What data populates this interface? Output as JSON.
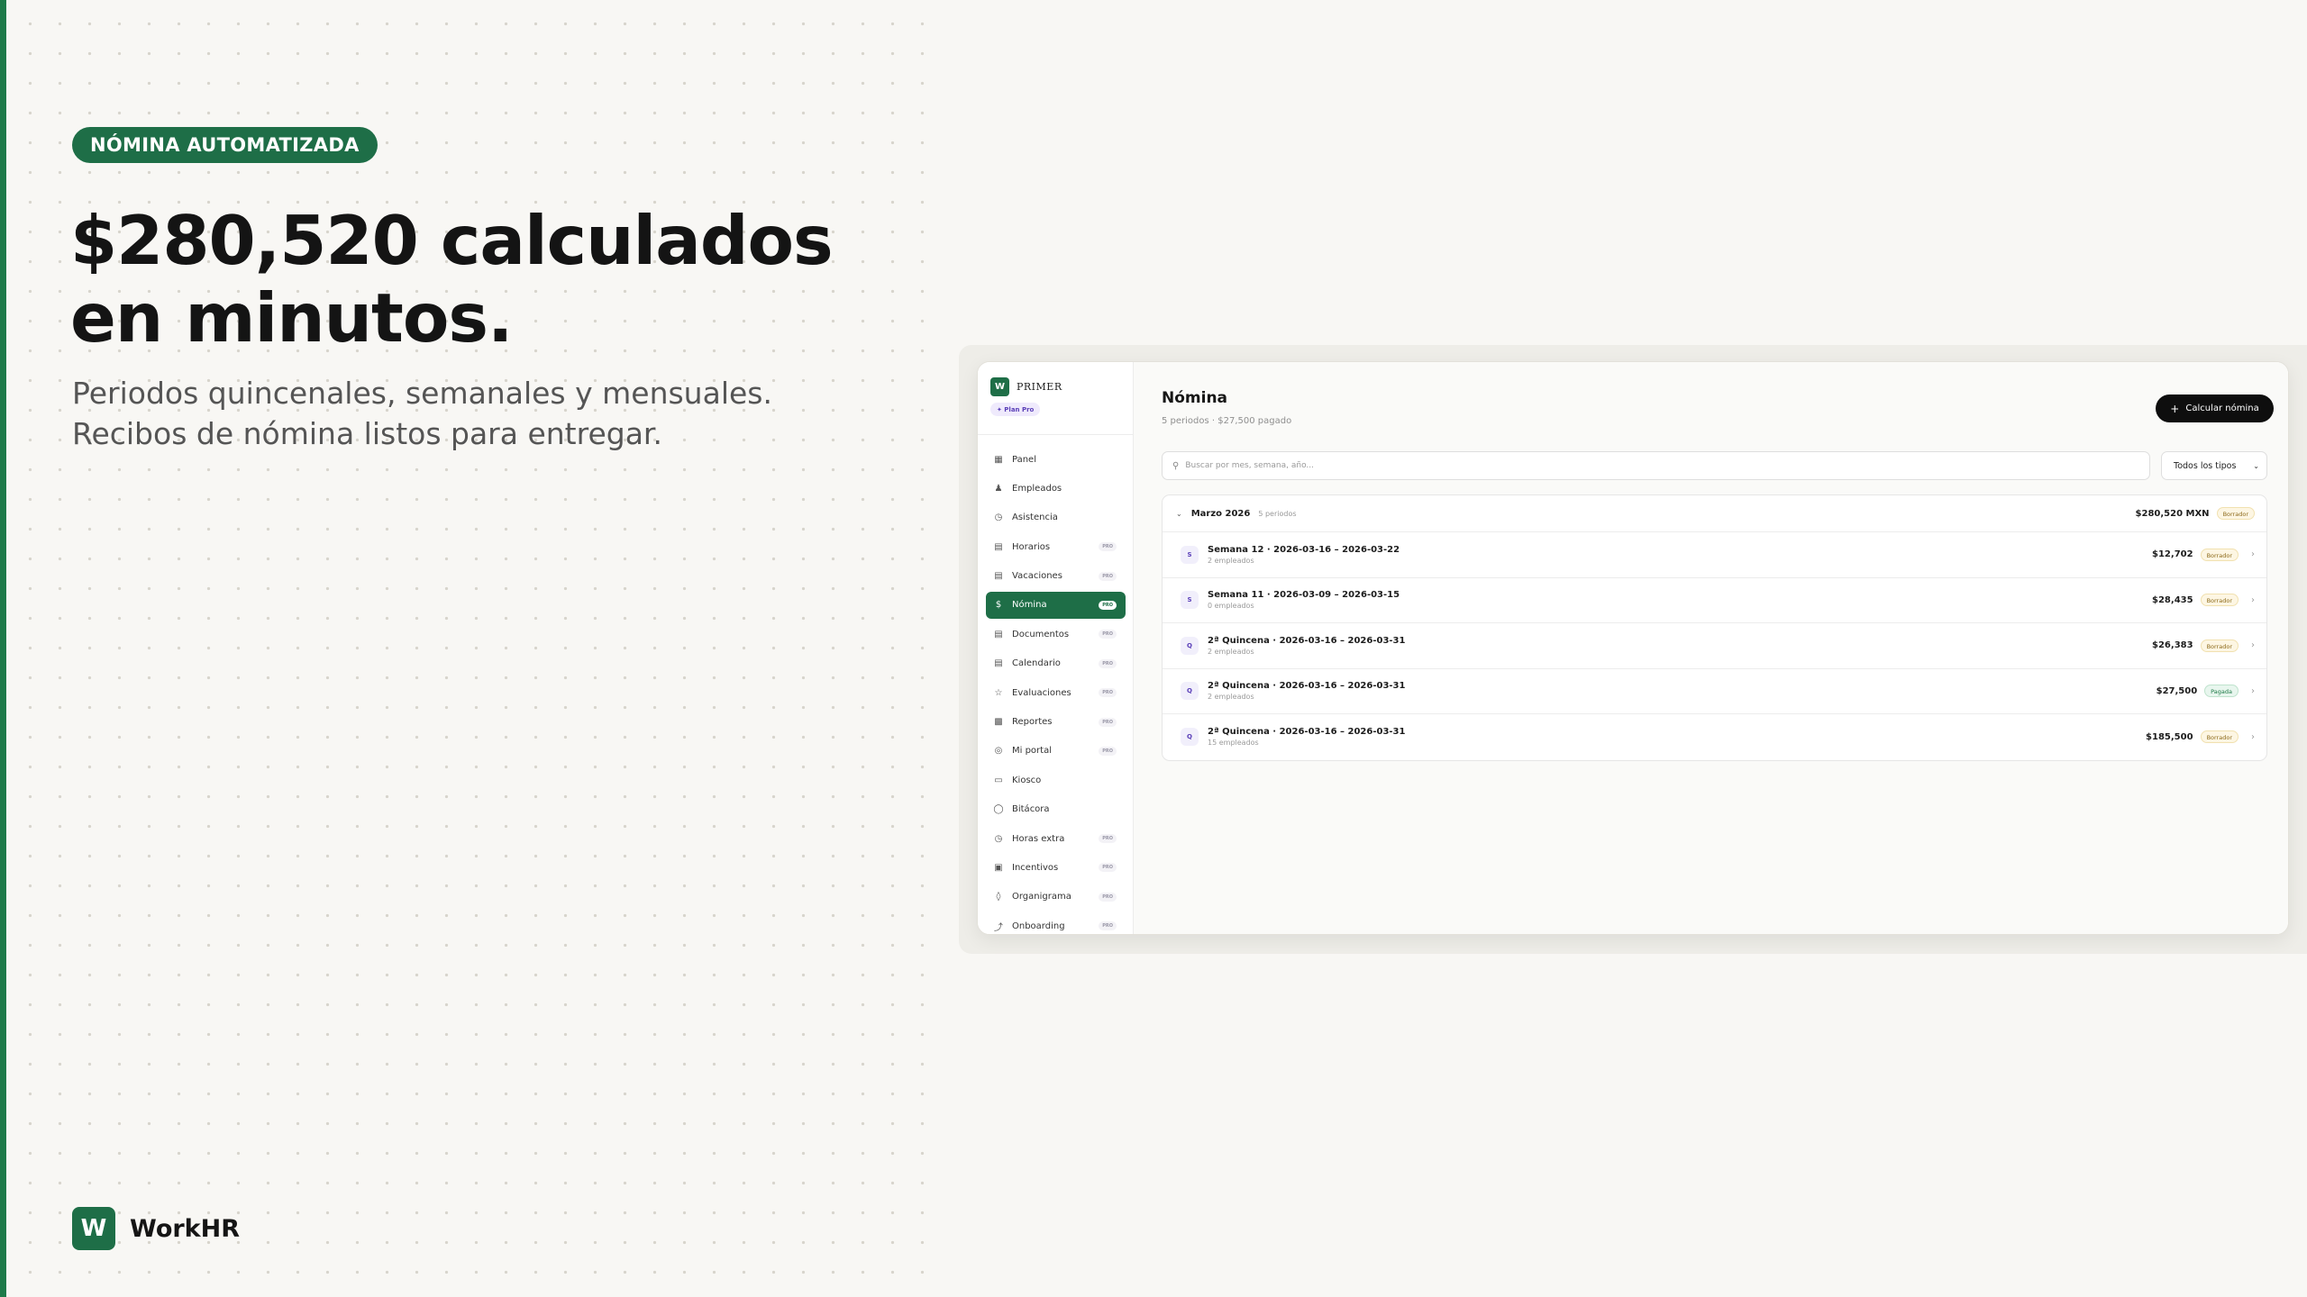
{
  "hero": {
    "badge": "NÓMINA AUTOMATIZADA",
    "title_line1": "$280,520 calculados",
    "title_line2": "en minutos.",
    "subtitle_line1": "Periodos quincenales, semanales y mensuales.",
    "subtitle_line2": "Recibos de nómina listos para entregar."
  },
  "brand": {
    "logo_letter": "W",
    "name": "WorkHR"
  },
  "colors": {
    "brand_green": "#1e6e47",
    "draft": "#8d6a1a",
    "paid": "#1f7a48",
    "pro_purple": "#5a3fb8"
  },
  "app": {
    "org": {
      "logo_letter": "W",
      "name": "PRIMER",
      "plan": "✦ Plan Pro"
    },
    "sidebar": {
      "items": [
        {
          "label": "Panel",
          "icon": "grid-icon",
          "pro": ""
        },
        {
          "label": "Empleados",
          "icon": "users-icon",
          "pro": ""
        },
        {
          "label": "Asistencia",
          "icon": "clock-icon",
          "pro": ""
        },
        {
          "label": "Horarios",
          "icon": "calendar-icon",
          "pro": "PRO"
        },
        {
          "label": "Vacaciones",
          "icon": "calendar-icon",
          "pro": "PRO"
        },
        {
          "label": "Nómina",
          "icon": "dollar-icon",
          "pro": "PRO"
        },
        {
          "label": "Documentos",
          "icon": "document-icon",
          "pro": "PRO"
        },
        {
          "label": "Calendario",
          "icon": "calendar-icon",
          "pro": "PRO"
        },
        {
          "label": "Evaluaciones",
          "icon": "star-icon",
          "pro": "PRO"
        },
        {
          "label": "Reportes",
          "icon": "bar-chart-icon",
          "pro": "PRO"
        },
        {
          "label": "Mi portal",
          "icon": "portal-icon",
          "pro": "PRO"
        },
        {
          "label": "Kiosco",
          "icon": "kiosk-icon",
          "pro": ""
        },
        {
          "label": "Bitácora",
          "icon": "shield-icon",
          "pro": ""
        },
        {
          "label": "Horas extra",
          "icon": "clock-icon",
          "pro": "PRO"
        },
        {
          "label": "Incentivos",
          "icon": "gift-icon",
          "pro": "PRO"
        },
        {
          "label": "Organigrama",
          "icon": "org-chart-icon",
          "pro": "PRO"
        },
        {
          "label": "Onboarding",
          "icon": "onboarding-icon",
          "pro": "PRO"
        }
      ]
    },
    "main": {
      "title": "Nómina",
      "subtitle": "5 periodos · $27,500 pagado",
      "calc_button": "Calcular nómina",
      "search_placeholder": "Buscar por mes, semana, año...",
      "filter_value": "Todos los tipos",
      "group": {
        "name": "Marzo 2026",
        "count": "5 periodos",
        "amount": "$280,520 MXN",
        "status": "Borrador"
      },
      "periods": [
        {
          "type": "S",
          "name": "Semana 12 · 2026-03-16 – 2026-03-22",
          "employees": "2 empleados",
          "amount": "$12,702",
          "status": "Borrador",
          "status_kind": "draft"
        },
        {
          "type": "S",
          "name": "Semana 11 · 2026-03-09 – 2026-03-15",
          "employees": "0 empleados",
          "amount": "$28,435",
          "status": "Borrador",
          "status_kind": "draft"
        },
        {
          "type": "Q",
          "name": "2ª Quincena · 2026-03-16 – 2026-03-31",
          "employees": "2 empleados",
          "amount": "$26,383",
          "status": "Borrador",
          "status_kind": "draft"
        },
        {
          "type": "Q",
          "name": "2ª Quincena · 2026-03-16 – 2026-03-31",
          "employees": "2 empleados",
          "amount": "$27,500",
          "status": "Pagada",
          "status_kind": "paid"
        },
        {
          "type": "Q",
          "name": "2ª Quincena · 2026-03-16 – 2026-03-31",
          "employees": "15 empleados",
          "amount": "$185,500",
          "status": "Borrador",
          "status_kind": "draft"
        }
      ]
    }
  }
}
